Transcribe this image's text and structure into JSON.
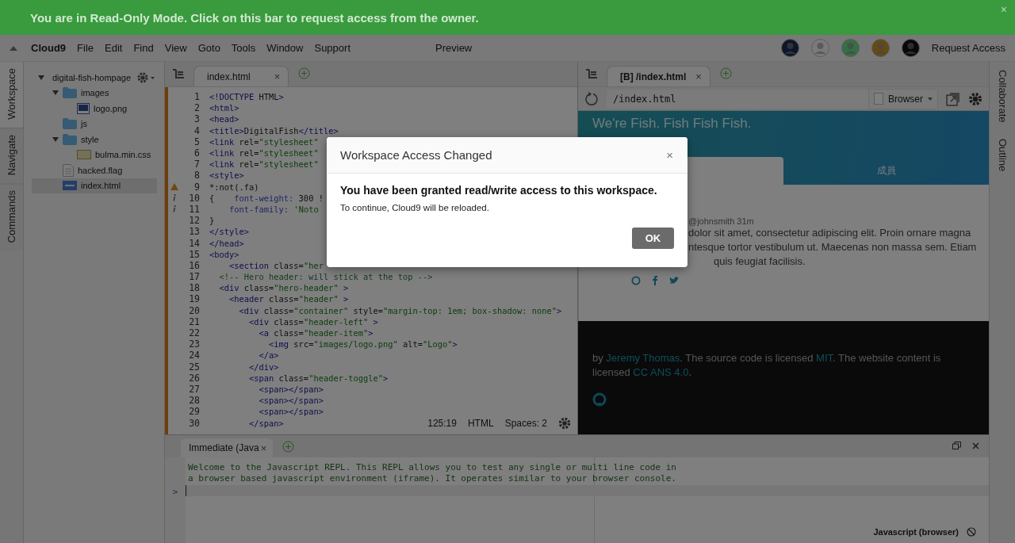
{
  "banner": {
    "text": "You are in Read-Only Mode. Click on this bar to request access from the owner.",
    "close": "×"
  },
  "menubar": {
    "brand": "Cloud9",
    "menus": [
      "File",
      "Edit",
      "Find",
      "View",
      "Goto",
      "Tools",
      "Window",
      "Support"
    ],
    "preview": "Preview",
    "request_access": "Request Access"
  },
  "left_tabs": [
    {
      "label": "Workspace",
      "selected": true
    },
    {
      "label": "Navigate",
      "selected": false
    },
    {
      "label": "Commands",
      "selected": false
    }
  ],
  "file_tree": [
    {
      "name": "digital-fish-hompage",
      "kind": "folder",
      "expanded": true,
      "selected": false,
      "children": [
        {
          "name": "images",
          "kind": "folder",
          "expanded": true,
          "selected": false,
          "children": [
            {
              "name": "logo.png",
              "kind": "image",
              "selected": false
            }
          ]
        },
        {
          "name": "js",
          "kind": "folder",
          "selected": false
        },
        {
          "name": "style",
          "kind": "folder",
          "expanded": true,
          "selected": false,
          "children": [
            {
              "name": "bulma.min.css",
              "kind": "css",
              "selected": false
            }
          ]
        },
        {
          "name": "hacked.flag",
          "kind": "file",
          "selected": false
        },
        {
          "name": "index.html",
          "kind": "html",
          "selected": true
        }
      ]
    }
  ],
  "editor": {
    "tabs": [
      {
        "label": "index.html",
        "close": "×",
        "selected": true
      }
    ],
    "lines": [
      {
        "number": "1",
        "code": "<!DOCTYPE HTML>"
      },
      {
        "number": "2",
        "code": "<html>"
      },
      {
        "number": "3",
        "code": "<head>"
      },
      {
        "number": "4",
        "code": "<title>DigitalFish</title>"
      },
      {
        "number": "5",
        "code": "<link rel=\"stylesheet\""
      },
      {
        "number": "6",
        "code": "<link rel=\"stylesheet\""
      },
      {
        "number": "7",
        "code": "<link rel=\"stylesheet\""
      },
      {
        "number": "8",
        "code": "<style>"
      },
      {
        "number": "9",
        "code": "*:not(.fa)",
        "kind": "warning"
      },
      {
        "number": "10",
        "code": "{    font-weight: 300 !",
        "kind": "info"
      },
      {
        "number": "11",
        "code": "    font-family: 'Noto",
        "kind": "info"
      },
      {
        "number": "12",
        "code": "}"
      },
      {
        "number": "13",
        "code": "</style>"
      },
      {
        "number": "14",
        "code": "</head>"
      },
      {
        "number": "15",
        "code": "<body>"
      },
      {
        "number": "16",
        "code": "    <section class=\"her"
      },
      {
        "number": "17",
        "code": "  <!-- Hero header: will stick at the top -->"
      },
      {
        "number": "18",
        "code": "  <div class=\"hero-header\" >"
      },
      {
        "number": "19",
        "code": "    <header class=\"header\" >"
      },
      {
        "number": "20",
        "code": "      <div class=\"container\" style=\"margin-top: 1em; box-shadow: none\">"
      },
      {
        "number": "21",
        "code": "        <div class=\"header-left\" >"
      },
      {
        "number": "22",
        "code": "          <a class=\"header-item\">"
      },
      {
        "number": "23",
        "code": "            <img src=\"images/logo.png\" alt=\"Logo\">"
      },
      {
        "number": "24",
        "code": "          </a>"
      },
      {
        "number": "25",
        "code": "        </div>"
      },
      {
        "number": "26",
        "code": "        <span class=\"header-toggle\">"
      },
      {
        "number": "27",
        "code": "          <span></span>"
      },
      {
        "number": "28",
        "code": "          <span></span>"
      },
      {
        "number": "29",
        "code": "          <span></span>"
      },
      {
        "number": "30",
        "code": "        </span>"
      }
    ],
    "status": {
      "position": "125:19",
      "mode": "HTML",
      "spaces": "Spaces: 2"
    }
  },
  "preview": {
    "tabs": [
      {
        "label": "[B] /index.html",
        "close": "×",
        "selected": true
      }
    ],
    "url": "/index.html",
    "browser": "Browser",
    "hero_title": "We're Fish. Fish Fish Fish.",
    "hero_tabs": [
      {
        "selected": true
      },
      {
        "label": "成員",
        "selected": false
      }
    ],
    "post_meta": "@johnsmith 31m",
    "post_lines": [
      "dolor sit amet, consectetur adipiscing elit. Proin ornare magna",
      "ntesque tortor vestibulum ut. Maecenas non massa sem. Etiam",
      "quis feugiat facilisis."
    ],
    "footer": [
      {
        "kind": "text",
        "text": "by "
      },
      {
        "kind": "link",
        "text": "Jeremy Thomas"
      },
      {
        "kind": "text",
        "text": ". The source code is licensed "
      },
      {
        "kind": "link",
        "text": "MIT"
      },
      {
        "kind": "text",
        "text": ". The website content is licensed "
      },
      {
        "kind": "link",
        "text": "CC ANS 4.0"
      },
      {
        "kind": "text",
        "text": "."
      }
    ]
  },
  "right_tabs": [
    {
      "label": "Collaborate"
    },
    {
      "label": "Outline"
    }
  ],
  "console": {
    "tabs": [
      {
        "label": "Immediate (Java",
        "close": "×",
        "selected": true
      }
    ],
    "lines": [
      "Welcome to the Javascript REPL. This REPL allows you to test any single or multi line code in",
      "a browser based javascript environment (iframe). It operates similar to your browser console."
    ],
    "prompt": ">",
    "mode": "Javascript (browser)"
  },
  "modal": {
    "title": "Workspace Access Changed",
    "close": "×",
    "heading": "You have been granted read/write access to this workspace.",
    "body": "To continue, Cloud9 will be reloaded.",
    "button": "OK"
  }
}
